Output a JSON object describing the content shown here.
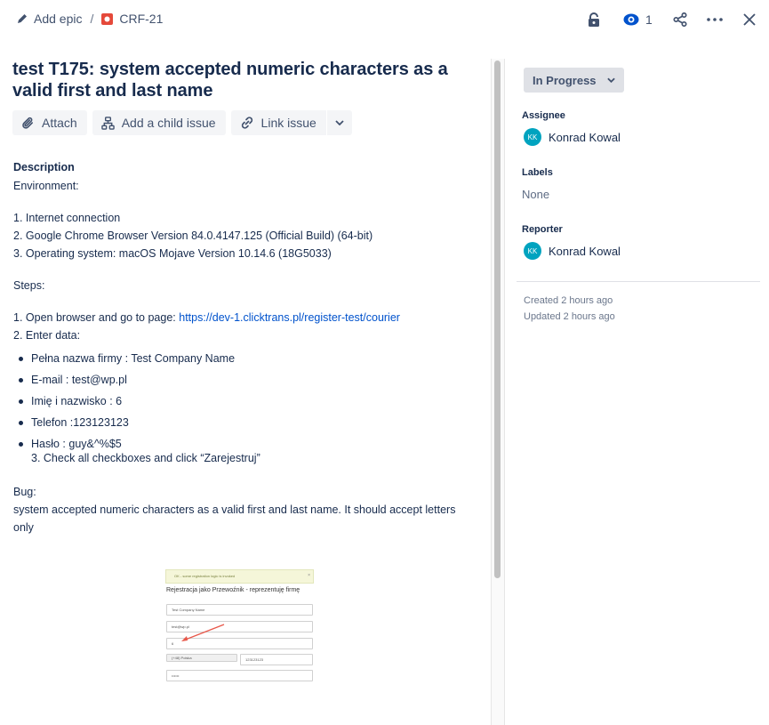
{
  "breadcrumb": {
    "epic_label": "Add epic",
    "separator": "/",
    "issue_key": "CRF-21"
  },
  "header_actions": {
    "lock_icon": "lock-icon",
    "watch_count": "1",
    "share_icon": "share-icon",
    "more_icon": "more-icon",
    "close_icon": "close-icon"
  },
  "issue": {
    "title": "test T175: system accepted numeric characters as a valid first and last name",
    "toolbar": {
      "attach": "Attach",
      "add_child": "Add a child issue",
      "link": "Link issue"
    }
  },
  "description": {
    "heading": "Description",
    "environment_label": "Environment:",
    "env_items": [
      "1. Internet connection",
      "2. Google Chrome Browser Version 84.0.4147.125 (Official Build) (64-bit)",
      "3. Operating system: macOS Mojave Version 10.14.6 (18G5033)"
    ],
    "steps_label": "Steps:",
    "step1_prefix": "1. Open browser and go to page: ",
    "step1_link": "https://dev-1.clicktrans.pl/register-test/courier",
    "step2": "2. Enter data:",
    "data_items": [
      "Pełna nazwa firmy : Test Company Name",
      "E-mail : test@wp.pl",
      "Imię i nazwisko : 6",
      "Telefon :123123123",
      "Hasło : guy&^%$5"
    ],
    "step3": "3. Check all checkboxes and click “Zarejestruj”",
    "bug_label": "Bug:",
    "bug_text": "system accepted numeric characters as a valid first and last name. It should accept letters only"
  },
  "attachment": {
    "alert": "OK - some registration logic is invoked",
    "alert_close": "×",
    "heading": "Rejestracja jako Przewoźnik - reprezentuję firmę",
    "company": "Test Company Name",
    "email": "test@wp.pl",
    "name": "6",
    "country": "(+48) Polska",
    "phone": "123123123",
    "password": "••••••"
  },
  "sidebar": {
    "status": "In Progress",
    "assignee_label": "Assignee",
    "assignee_initials": "KK",
    "assignee_name": "Konrad Kowal",
    "labels_label": "Labels",
    "labels_value": "None",
    "reporter_label": "Reporter",
    "reporter_initials": "KK",
    "reporter_name": "Konrad Kowal",
    "created": "Created 2 hours ago",
    "updated": "Updated 2 hours ago"
  },
  "colors": {
    "link": "#0052CC",
    "avatar": "#00A3BF",
    "issue_type": "#E5493A",
    "watch": "#0052CC"
  }
}
